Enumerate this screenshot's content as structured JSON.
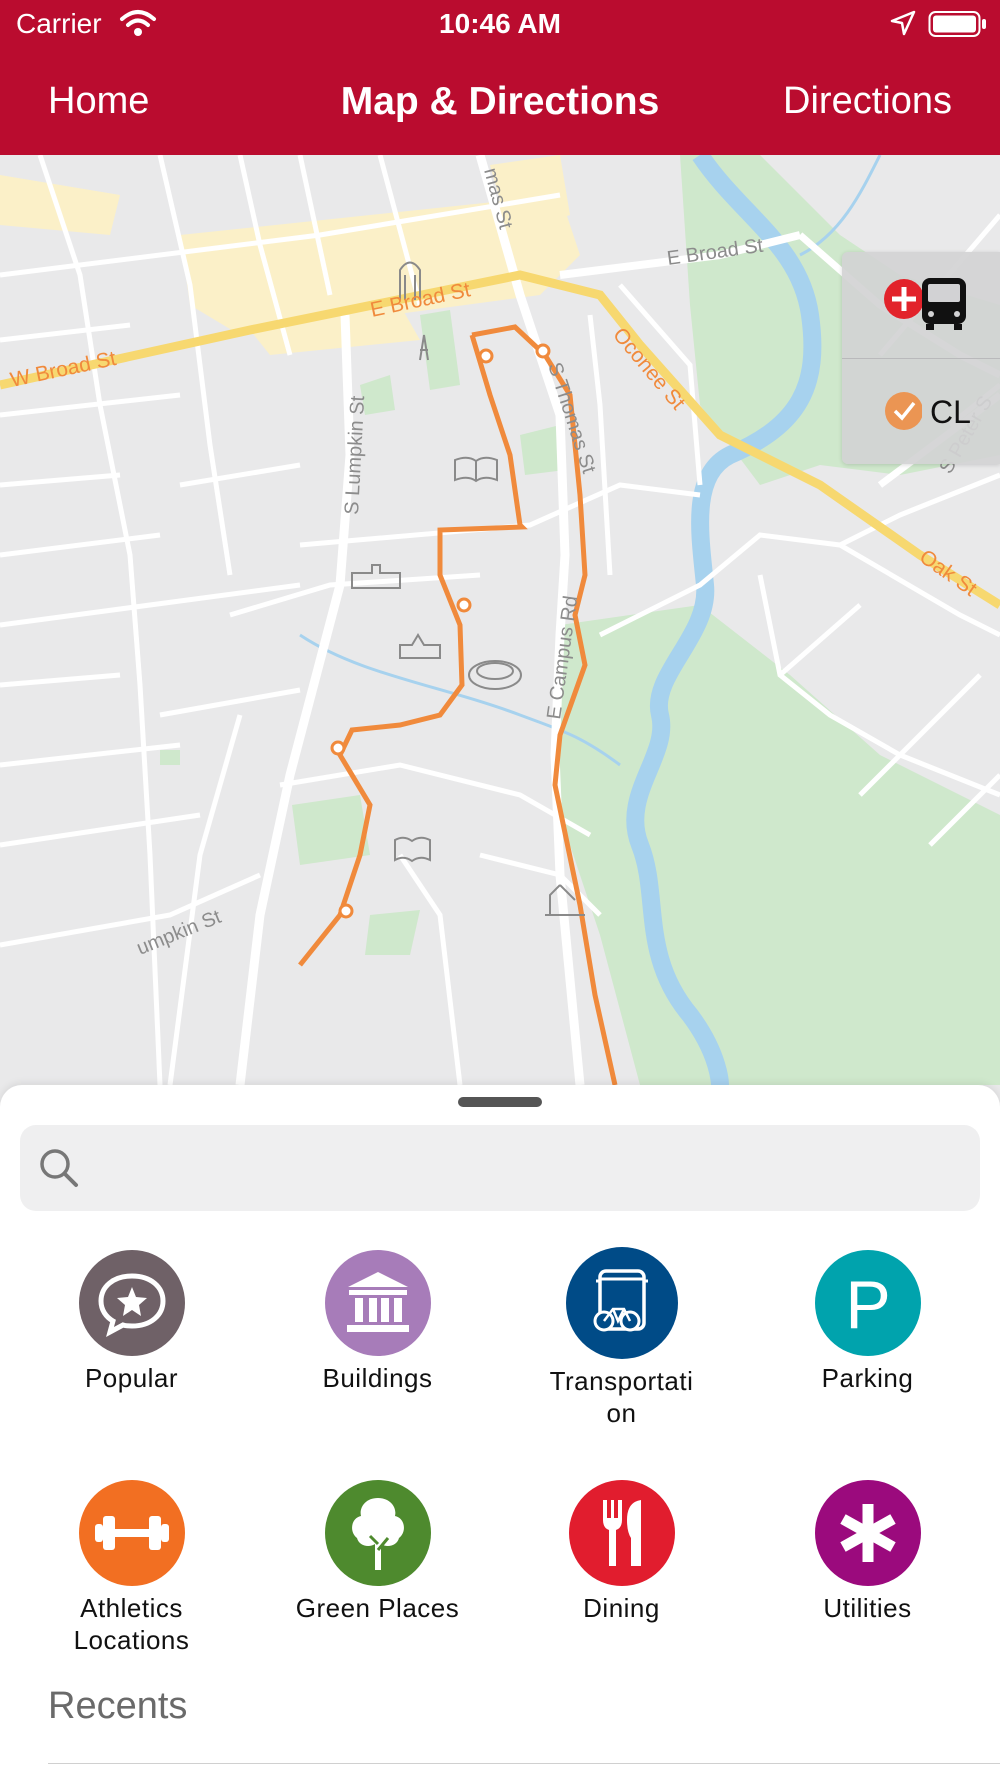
{
  "status_bar": {
    "carrier": "Carrier",
    "time": "10:46 AM"
  },
  "nav": {
    "home": "Home",
    "title": "Map & Directions",
    "directions": "Directions"
  },
  "map": {
    "streets": {
      "w_broad": "W Broad St",
      "e_broad_1": "E Broad St",
      "e_broad_2": "E Broad St",
      "thomas_1": "mas St",
      "thomas_2": "S Thomas St",
      "oconee": "Oconee St",
      "lumpkin_1": "S Lumpkin St",
      "lumpkin_2": "umpkin St",
      "oak": "Oak St",
      "peter": "S Peter S",
      "campus_dr": "E Campus Rd"
    },
    "colors": {
      "route": "#f08a3c",
      "water": "#a7d2ee",
      "park": "#cfe8cc",
      "downtown": "#fbf0c8",
      "road_major": "#f7d870"
    },
    "controls": {
      "cl_label": "CL"
    }
  },
  "search": {
    "placeholder": "",
    "value": ""
  },
  "categories": [
    {
      "label": "Popular",
      "color": "#6f6167",
      "icon": "star-chat-icon"
    },
    {
      "label": "Buildings",
      "color": "#a77cb9",
      "icon": "building-icon"
    },
    {
      "label": "Transportati\non",
      "color": "#004b87",
      "icon": "bus-bike-icon"
    },
    {
      "label": "Parking",
      "color": "#00a3ad",
      "icon": "parking-icon"
    },
    {
      "label": "Athletics\nLocations",
      "color": "#f26f22",
      "icon": "dumbbell-icon"
    },
    {
      "label": "Green Places",
      "color": "#4e8a2e",
      "icon": "tree-icon"
    },
    {
      "label": "Dining",
      "color": "#e11d2e",
      "icon": "fork-knife-icon"
    },
    {
      "label": "Utilities",
      "color": "#9b0a7d",
      "icon": "asterisk-icon"
    }
  ],
  "recents": {
    "title": "Recents"
  }
}
